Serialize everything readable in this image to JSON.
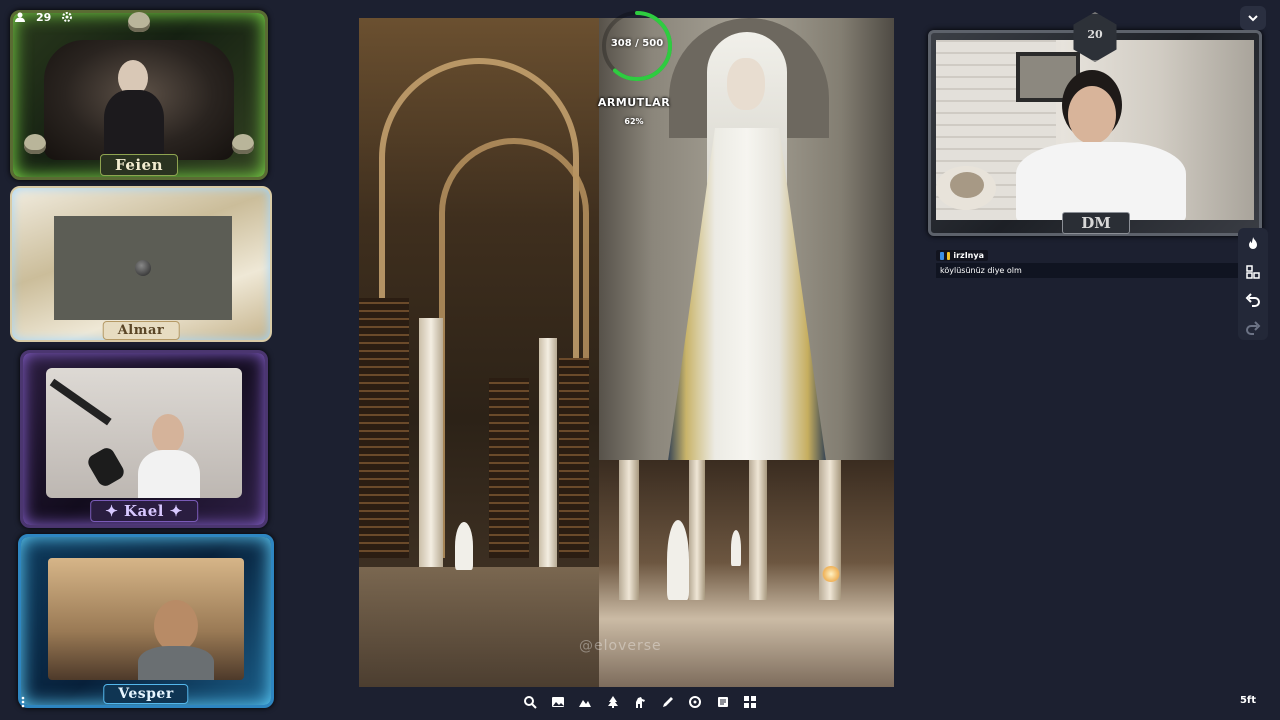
{
  "top_tools": {
    "count": "29"
  },
  "players": [
    {
      "name": "Feien"
    },
    {
      "name": "Almar"
    },
    {
      "name": "✦ Kael ✦"
    },
    {
      "name": "Vesper"
    }
  ],
  "token": {
    "hp_text": "308 / 500",
    "hp_current": 308,
    "hp_max": 500,
    "name": "ARMUTLAR",
    "percent": "62%"
  },
  "map": {
    "watermark": "@eloverse"
  },
  "dm": {
    "die_value": "20",
    "plate": "DM"
  },
  "chat": {
    "username": "irzInya",
    "message": "köylüsünüz diye olm"
  },
  "scale": {
    "label": "5ft"
  },
  "colors": {
    "hp_ring": "#2ecc40",
    "background": "#1c2030"
  }
}
